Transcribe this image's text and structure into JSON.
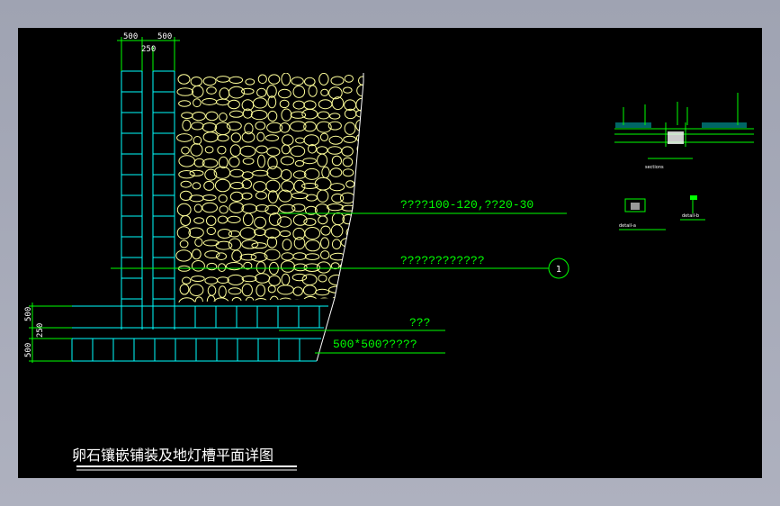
{
  "drawing": {
    "title": "卵石镶嵌铺装及地灯槽平面详图",
    "callout_number": "1"
  },
  "dimensions": {
    "top_left": "500",
    "top_right": "500",
    "top_mid": "250",
    "side_top": "500",
    "side_mid": "250",
    "side_bottom": "500"
  },
  "annotations": {
    "pebble_spec": "????100-120,??20-30",
    "lamp_slot": "????????????",
    "short_note": "???",
    "paving_spec": "500*500?????"
  },
  "thumbnails": {
    "section_label": "sections",
    "detail_a_label": "detail-a",
    "detail_b_label": "detail-b"
  },
  "colors": {
    "background": "#000000",
    "frame": "#a7aab8",
    "tile_lines": "#00ffff",
    "guide_lines": "#00ff00",
    "pebbles": "#ffff99",
    "dimension_text": "#ffffff"
  }
}
